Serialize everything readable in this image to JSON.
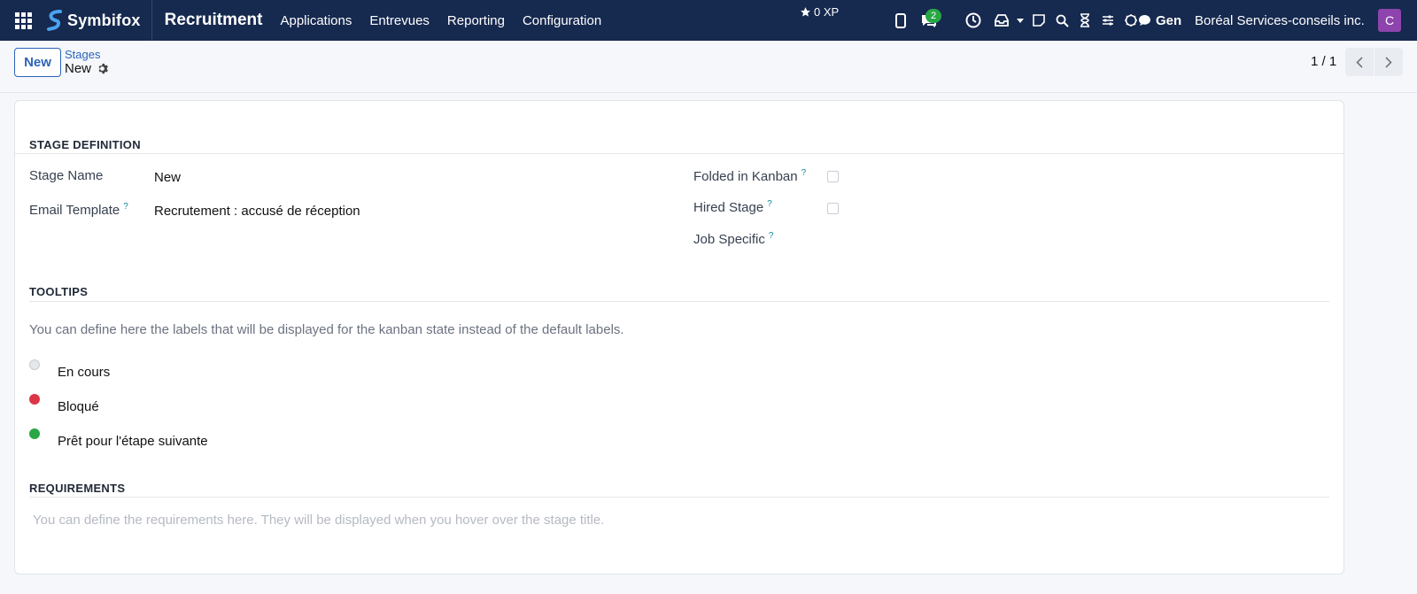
{
  "navbar": {
    "brand": "Symbifox",
    "app_title": "Recruitment",
    "menu": [
      "Applications",
      "Entrevues",
      "Reporting",
      "Configuration"
    ],
    "xp": "0 XP",
    "messages_badge": "2",
    "gen_label": "Gen",
    "company": "Boréal Services-conseils inc.",
    "avatar_initial": "C"
  },
  "control": {
    "new_button": "New",
    "breadcrumb_parent": "Stages",
    "breadcrumb_current": "New",
    "pager": "1 / 1"
  },
  "form": {
    "stage_definition": {
      "title": "STAGE DEFINITION",
      "stage_name_label": "Stage Name",
      "stage_name_value": "New",
      "email_template_label": "Email Template",
      "email_template_value": "Recrutement : accusé de réception",
      "folded_label": "Folded in Kanban",
      "folded_checked": false,
      "hired_label": "Hired Stage",
      "hired_checked": false,
      "job_specific_label": "Job Specific"
    },
    "tooltips": {
      "title": "TOOLTIPS",
      "description": "You can define here the labels that will be displayed for the kanban state instead of the default labels.",
      "states": [
        {
          "label": "En cours",
          "color": "#e5e7eb"
        },
        {
          "label": "Bloqué",
          "color": "#dc3545"
        },
        {
          "label": "Prêt pour l'étape suivante",
          "color": "#28a745"
        }
      ]
    },
    "requirements": {
      "title": "REQUIREMENTS",
      "placeholder": "You can define the requirements here. They will be displayed when you hover over the stage title."
    }
  },
  "help_mark": "?"
}
